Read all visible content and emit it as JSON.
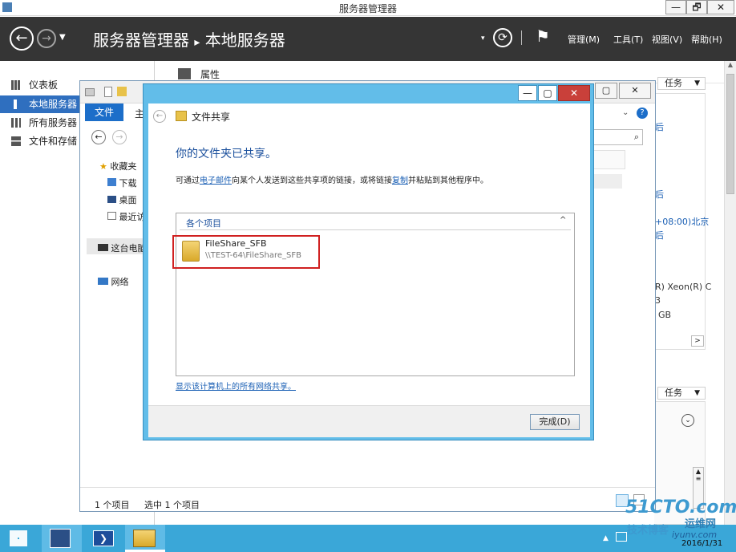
{
  "window": {
    "title": "服务器管理器",
    "min": "—",
    "max": "🗗",
    "close": "✕"
  },
  "header": {
    "breadcrumb_root": "服务器管理器",
    "breadcrumb_sep": "▸",
    "breadcrumb_current": "本地服务器",
    "menus": [
      "管理(M)",
      "工具(T)",
      "视图(V)",
      "帮助(H)"
    ],
    "refresh_glyph": "⟳",
    "flag_glyph": "⚑"
  },
  "leftnav": {
    "items": [
      {
        "label": "仪表板"
      },
      {
        "label": "本地服务器"
      },
      {
        "label": "所有服务器"
      },
      {
        "label": "文件和存储"
      }
    ]
  },
  "content": {
    "properties_title": "属性",
    "tasks_label_1": "任务",
    "tasks_label_2": "任务",
    "right_fragments": [
      "+08:00)北京",
      "R) Xeon(R) C",
      "GB",
      "3",
      "后",
      "后"
    ]
  },
  "explorer": {
    "file_tab": "文件",
    "home_tab": "主",
    "tree": {
      "favorites": "收藏夹",
      "downloads": "下载",
      "desktop": "桌面",
      "recent": "最近访",
      "this_pc": "这台电脑",
      "network": "网络"
    },
    "status_count": "1 个项目",
    "status_selected": "选中 1 个项目"
  },
  "dialog": {
    "title": "文件共享",
    "heading": "你的文件夹已共享。",
    "desc_prefix": "可通过",
    "desc_link1": "电子邮件",
    "desc_mid": "向某个人发送到这些共享项的链接，或将链接",
    "desc_link2": "复制",
    "desc_suffix": "并粘贴到其他程序中。",
    "list_header": "各个项目",
    "item_name": "FileShare_SFB",
    "item_path": "\\\\TEST-64\\FileShare_SFB",
    "show_all_link": "显示该计算机上的所有网络共享。",
    "done_button": "完成(D)"
  },
  "taskbar": {
    "date": "2016/1/31"
  },
  "watermark": {
    "line1": "51CTO.com",
    "line2": "技术博客",
    "line3": "运维网",
    "line4": "iyunv.com"
  },
  "colors": {
    "header_bg": "#353535",
    "nav_selected": "#2f6fbf",
    "dialog_frame": "#62bde9",
    "taskbar": "#3aa7d8",
    "close_red": "#c9403a",
    "highlight_box": "#d02020"
  }
}
